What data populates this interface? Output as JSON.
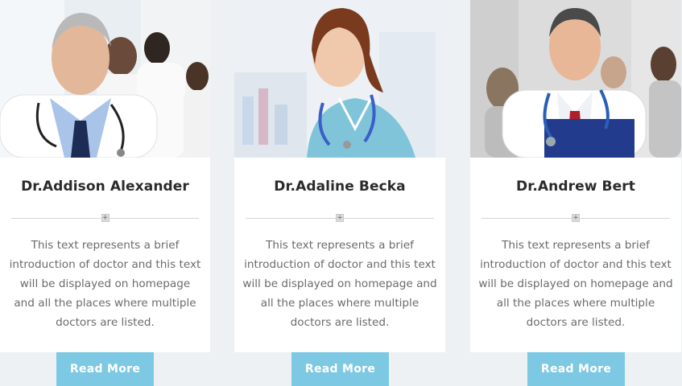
{
  "doctors": [
    {
      "name": "Dr.Addison Alexander",
      "bio": "This text represents a brief introduction of doctor and this text will be displayed on homepage and all the places where multiple doctors are listed.",
      "button": "Read More",
      "photo_icon": "doctor-portrait"
    },
    {
      "name": "Dr.Adaline Becka",
      "bio": "This text represents a brief introduction of doctor and this text will be displayed on homepage and all the places where multiple doctors are listed.",
      "button": "Read More",
      "photo_icon": "doctor-portrait"
    },
    {
      "name": "Dr.Andrew Bert",
      "bio": "This text represents a brief introduction of doctor and this text will be displayed on homepage and all the places where multiple doctors are listed.",
      "button": "Read More",
      "photo_icon": "doctor-portrait"
    }
  ],
  "divider_glyph": "+",
  "colors": {
    "button": "#7dc8e3",
    "background": "#eef1f4",
    "card": "#ffffff"
  }
}
